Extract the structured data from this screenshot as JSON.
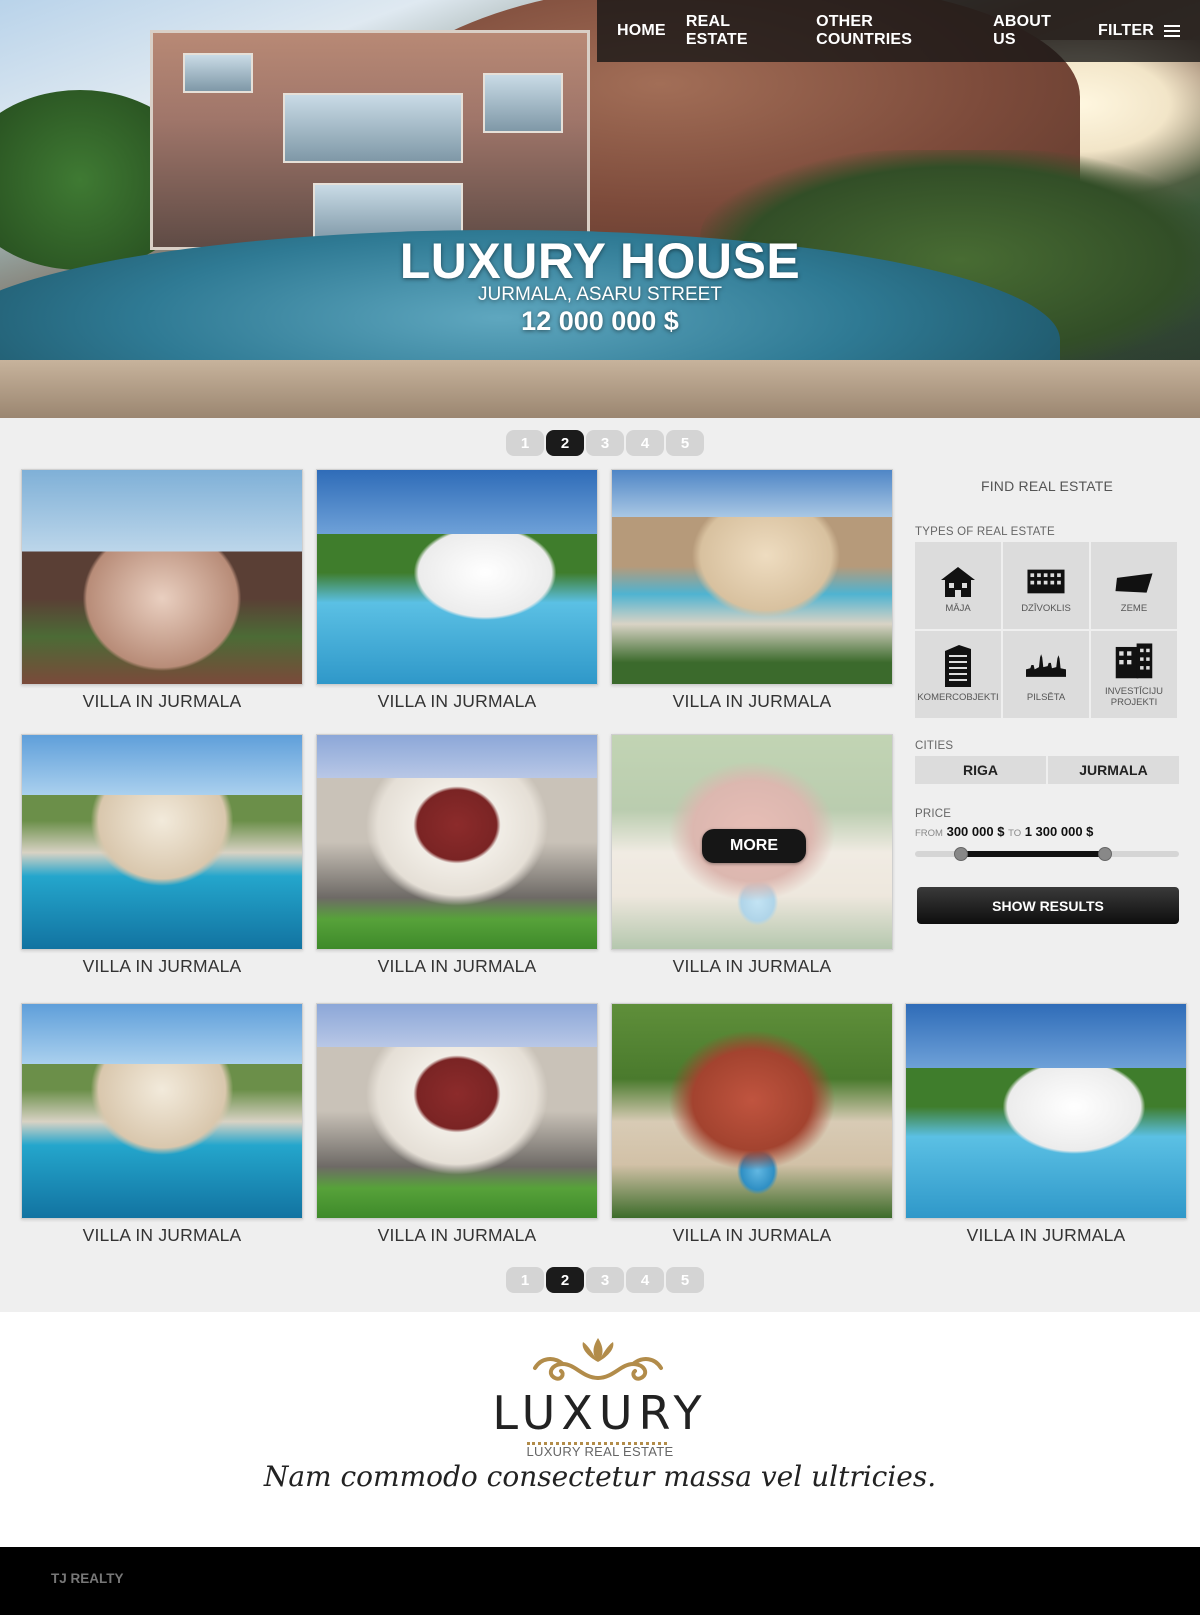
{
  "nav": {
    "items": [
      "HOME",
      "REAL ESTATE",
      "OTHER COUNTRIES",
      "ABOUT US"
    ],
    "filter_label": "FILTER"
  },
  "hero": {
    "title": "LUXURY HOUSE",
    "location": "JURMALA, ASARU STREET",
    "price": "12 000 000 $"
  },
  "pagination": {
    "pages": [
      "1",
      "2",
      "3",
      "4",
      "5"
    ],
    "active": "2"
  },
  "listings": [
    {
      "caption": "VILLA IN JURMALA",
      "image": "mansion-evening"
    },
    {
      "caption": "VILLA IN JURMALA",
      "image": "white-modern-pool"
    },
    {
      "caption": "VILLA IN JURMALA",
      "image": "mediterranean-villa"
    },
    {
      "caption": "VILLA IN JURMALA",
      "image": "pool-house"
    },
    {
      "caption": "VILLA IN JURMALA",
      "image": "red-roof-house"
    },
    {
      "caption": "VILLA IN JURMALA",
      "image": "aerial-estate",
      "overlay_button": "MORE"
    },
    {
      "caption": "VILLA IN JURMALA",
      "image": "pool-house"
    },
    {
      "caption": "VILLA IN JURMALA",
      "image": "red-roof-house"
    },
    {
      "caption": "VILLA IN JURMALA",
      "image": "aerial-estate"
    },
    {
      "caption": "VILLA IN JURMALA",
      "image": "white-modern-pool"
    }
  ],
  "sidebar": {
    "title": "FIND REAL ESTATE",
    "types_label": "TYPES OF REAL ESTATE",
    "types": [
      {
        "label": "MĀJA",
        "icon": "house-icon"
      },
      {
        "label": "DZĪVOKLIS",
        "icon": "apartment-building-icon"
      },
      {
        "label": "ZEME",
        "icon": "land-icon"
      },
      {
        "label": "KOMERCOBJEKTI",
        "icon": "office-tower-icon"
      },
      {
        "label": "PILSĒTA",
        "icon": "city-skyline-icon"
      },
      {
        "label": "INVESTĪCIJU PROJEKTI",
        "icon": "investment-building-icon"
      }
    ],
    "cities_label": "CITIES",
    "cities": [
      "RIGA",
      "JURMALA"
    ],
    "price_label": "PRICE",
    "price_from_label": "FROM",
    "price_from": "300 000 $",
    "price_to_label": "TO",
    "price_to": "1 300 000 $",
    "show_results": "SHOW RESULTS"
  },
  "logo": {
    "word": "LUXURY",
    "subtitle": "LUXURY REAL ESTATE",
    "tagline": "Nam commodo consectetur massa vel ultricies."
  },
  "footer": {
    "brand": "TJ REALTY"
  },
  "colors": {
    "accent_gold": "#b28c4a",
    "dark": "#111111",
    "page_bg": "#efefef"
  }
}
